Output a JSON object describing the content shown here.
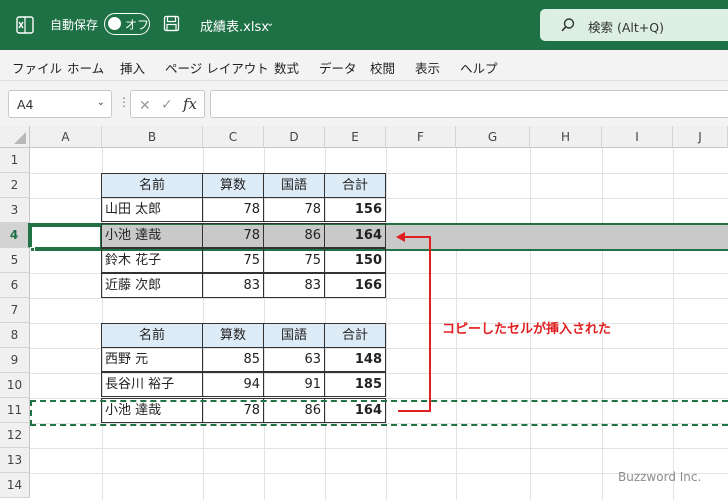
{
  "titlebar": {
    "autosave_label": "自動保存",
    "toggle_label": "オフ",
    "filename": "成績表.xlsx",
    "search_placeholder": "検索 (Alt+Q)"
  },
  "menu": [
    "ファイル",
    "ホーム",
    "挿入",
    "ページ レイアウト",
    "数式",
    "データ",
    "校閲",
    "表示",
    "ヘルプ"
  ],
  "formula_bar": {
    "name_box": "A4",
    "fx": "fx",
    "formula": ""
  },
  "columns": [
    "A",
    "B",
    "C",
    "D",
    "E",
    "F",
    "G",
    "H",
    "I",
    "J"
  ],
  "rows": [
    "1",
    "2",
    "3",
    "4",
    "5",
    "6",
    "7",
    "8",
    "9",
    "10",
    "11",
    "12",
    "13",
    "14"
  ],
  "table1": {
    "headers": [
      "名前",
      "算数",
      "国語",
      "合計"
    ],
    "rows": [
      [
        "山田 太郎",
        "78",
        "78",
        "156"
      ],
      [
        "小池 達哉",
        "78",
        "86",
        "164"
      ],
      [
        "鈴木 花子",
        "75",
        "75",
        "150"
      ],
      [
        "近藤 次郎",
        "83",
        "83",
        "166"
      ]
    ]
  },
  "table2": {
    "headers": [
      "名前",
      "算数",
      "国語",
      "合計"
    ],
    "rows": [
      [
        "西野 元",
        "85",
        "63",
        "148"
      ],
      [
        "長谷川 裕子",
        "94",
        "91",
        "185"
      ],
      [
        "小池 達哉",
        "78",
        "86",
        "164"
      ]
    ]
  },
  "annotation": "コピーしたセルが挿入された",
  "watermark": "Buzzword Inc.",
  "colors": {
    "excel_green": "#1e7145",
    "selection_green": "#217346",
    "header_fill": "#ddebf7",
    "annotation_red": "#e02020",
    "highlight_row": "#c9c9c9"
  }
}
